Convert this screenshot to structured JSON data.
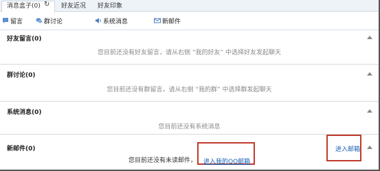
{
  "tabs": {
    "inbox_label": "消息盒子(0)",
    "friends_label": "好友近况",
    "impression_label": "好友印象"
  },
  "toolbar": {
    "message_label": "留言",
    "group_label": "群讨论",
    "system_label": "系统消息",
    "mail_label": "新邮件"
  },
  "sections": {
    "friend_msg": {
      "title": "好友留言(0)",
      "empty": "您目前还没有好友留言，请从右侧 “我的好友” 中选择好友发起聊天"
    },
    "group": {
      "title": "群讨论(0)",
      "empty": "您目前还没有群留言，请从右侧 “我的群” 中选择群发起聊天"
    },
    "system": {
      "title": "系统消息(0)",
      "empty": "您目前还没有系统消息"
    },
    "mail": {
      "title": "新邮件(0)",
      "empty": "您目前还没有未读邮件，",
      "link": "进入我的QQ邮箱",
      "enter": "进入邮箱"
    }
  },
  "colors": {
    "accent_link": "#1a5fb4",
    "highlight_box": "#c0392b",
    "tab_bg": "#eef3f8"
  }
}
